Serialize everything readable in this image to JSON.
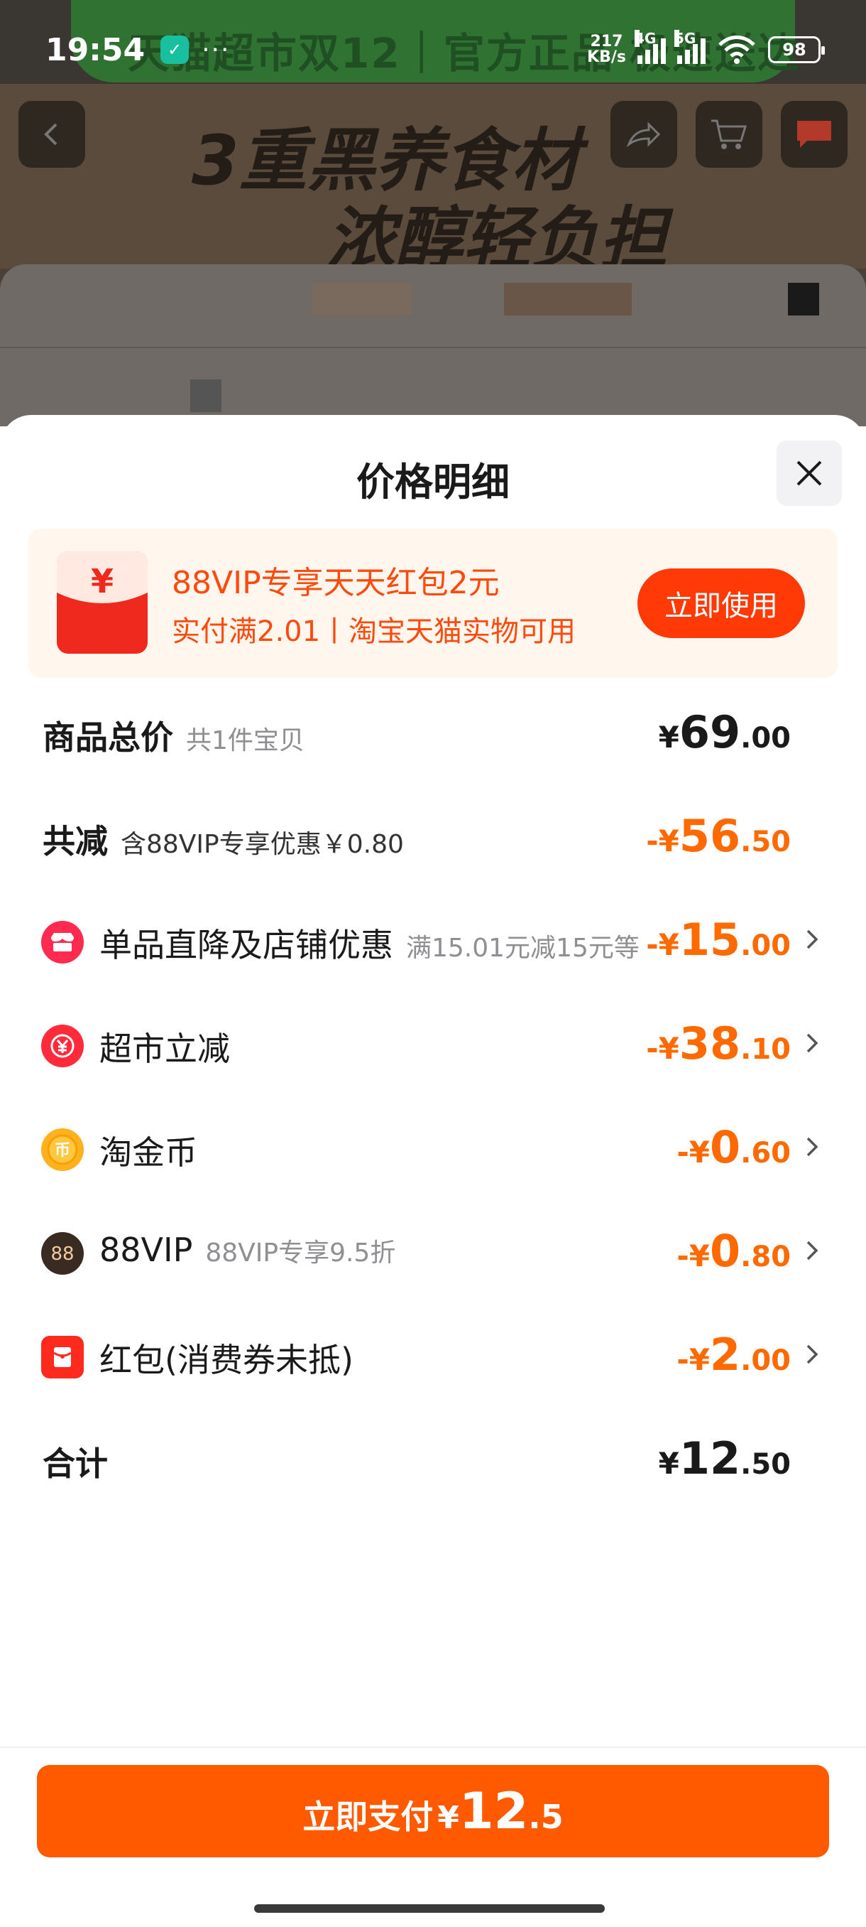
{
  "status_bar": {
    "time": "19:54",
    "dots": "···",
    "net_speed_value": "217",
    "net_speed_unit": "KB/s",
    "signal_1": "4G",
    "signal_2": "5G",
    "battery": "98"
  },
  "background": {
    "promo_text": "天猫超市双12｜官方正品 极速送达",
    "hero_line1": "3重黑养食材",
    "hero_line2": "浓醇轻负担"
  },
  "sheet": {
    "title": "价格明细",
    "close_icon": "close-icon"
  },
  "promo": {
    "icon_glyph": "¥",
    "title": "88VIP专享天天红包2元",
    "subtitle": "实付满2.01丨淘宝天猫实物可用",
    "button": "立即使用"
  },
  "rows": {
    "total": {
      "label": "商品总价",
      "note": "共1件宝贝",
      "sym": "¥",
      "int": "69",
      "dec": ".00"
    },
    "discount": {
      "label": "共减",
      "note": "含88VIP专享优惠￥0.80",
      "sym": "-¥",
      "int": "56",
      "dec": ".50"
    },
    "shop": {
      "label": "单品直降及店铺优惠",
      "note": "满15.01元减15元等",
      "sym": "-¥",
      "int": "15",
      "dec": ".00"
    },
    "market": {
      "label": "超市立减",
      "sym": "-¥",
      "int": "38",
      "dec": ".10"
    },
    "coin": {
      "label": "淘金币",
      "sym": "-¥",
      "int": "0",
      "dec": ".60"
    },
    "vip": {
      "label": "88VIP",
      "note": "88VIP专享9.5折",
      "sym": "-¥",
      "int": "0",
      "dec": ".80"
    },
    "redpacket": {
      "label": "红包(消费券未抵)",
      "sym": "-¥",
      "int": "2",
      "dec": ".00"
    },
    "sum": {
      "label": "合计",
      "sym": "¥",
      "int": "12",
      "dec": ".50"
    }
  },
  "icons": {
    "shop": "store-icon",
    "market": "market-discount-icon",
    "coin": "coin-icon",
    "vip": "vip-88-icon",
    "vip_glyph": "88",
    "coin_glyph": "币",
    "redpacket": "red-packet-icon"
  },
  "footer": {
    "pay_label": "立即支付",
    "pay_sym": "¥",
    "pay_int": "12",
    "pay_dec": ".5"
  },
  "colors": {
    "accent_orange": "#ff6a00",
    "promo_red": "#ff3a06",
    "pay_button": "#ff5a00"
  }
}
